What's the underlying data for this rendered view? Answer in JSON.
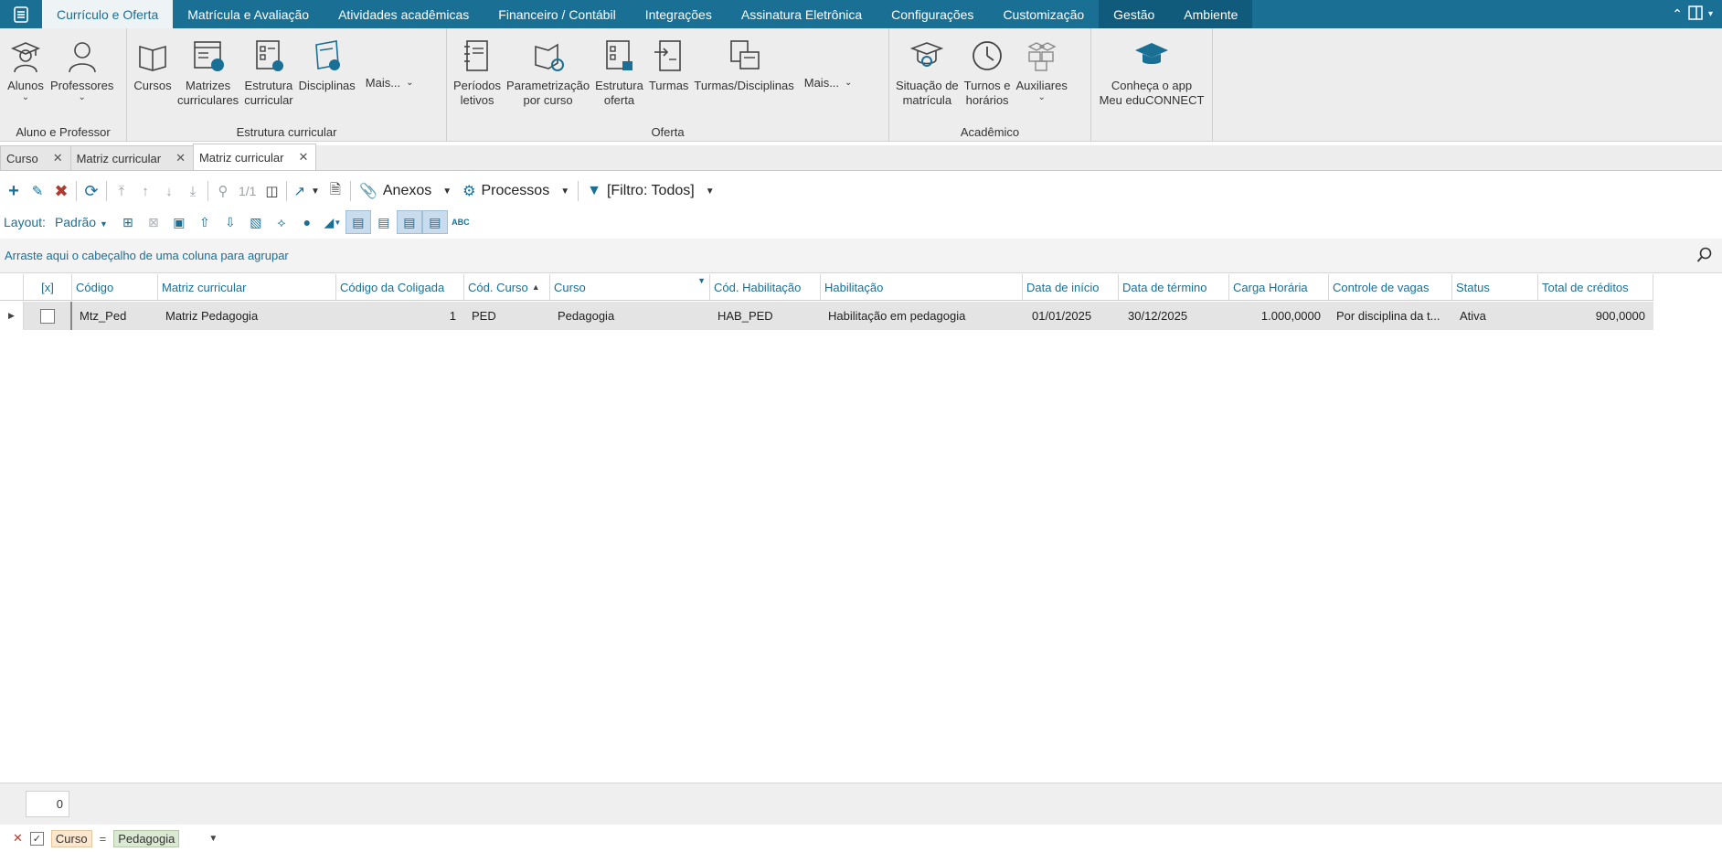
{
  "menubar": {
    "tabs": [
      {
        "label": "Currículo e Oferta",
        "active": true
      },
      {
        "label": "Matrícula e Avaliação"
      },
      {
        "label": "Atividades acadêmicas"
      },
      {
        "label": "Financeiro / Contábil"
      },
      {
        "label": "Integrações"
      },
      {
        "label": "Assinatura Eletrônica"
      },
      {
        "label": "Configurações"
      },
      {
        "label": "Customização"
      },
      {
        "label": "Gestão",
        "alt": true
      },
      {
        "label": "Ambiente",
        "alt": true
      }
    ]
  },
  "ribbon": {
    "group1": {
      "label": "Aluno e Professor",
      "alunos": "Alunos",
      "professores": "Professores"
    },
    "group2": {
      "label": "Estrutura curricular",
      "cursos": "Cursos",
      "matrizes": "Matrizes\ncurriculares",
      "estrutura": "Estrutura\ncurricular",
      "disciplinas": "Disciplinas",
      "mais": "Mais..."
    },
    "group3": {
      "label": "Oferta",
      "periodos": "Períodos\nletivos",
      "parametrizacao": "Parametrização\npor curso",
      "estrutura_oferta": "Estrutura\noferta",
      "turmas": "Turmas",
      "turmas_disciplinas": "Turmas/Disciplinas",
      "mais": "Mais..."
    },
    "group4": {
      "label": "Acadêmico",
      "situacao": "Situação de\nmatrícula",
      "turnos": "Turnos e\nhorários",
      "auxiliares": "Auxiliares"
    },
    "group5": {
      "app": "Conheça o app\nMeu eduCONNECT"
    }
  },
  "doctabs": [
    {
      "label": "Curso"
    },
    {
      "label": "Matriz curricular"
    },
    {
      "label": "Matriz curricular",
      "active": true
    }
  ],
  "toolbar": {
    "record_nav": "1/1",
    "anexos": "Anexos",
    "processos": "Processos",
    "filtro": "[Filtro: Todos]"
  },
  "layoutbar": {
    "label": "Layout:",
    "value": "Padrão"
  },
  "groupbar": {
    "hint": "Arraste aqui o cabeçalho de uma coluna para agrupar"
  },
  "grid": {
    "columns": [
      "[x]",
      "Código",
      "Matriz curricular",
      "Código da Coligada",
      "Cód. Curso",
      "Curso",
      "Cód. Habilitação",
      "Habilitação",
      "Data de início",
      "Data de término",
      "Carga Horária",
      "Controle de vagas",
      "Status",
      "Total de créditos"
    ],
    "rows": [
      {
        "codigo": "Mtz_Ped",
        "matriz": "Matriz Pedagogia",
        "coligada": "1",
        "cod_curso": "PED",
        "curso": "Pedagogia",
        "cod_habilitacao": "HAB_PED",
        "habilitacao": "Habilitação em pedagogia",
        "data_inicio": "01/01/2025",
        "data_termino": "30/12/2025",
        "carga_horaria": "1.000,0000",
        "controle_vagas": "Por disciplina da t...",
        "status": "Ativa",
        "total_creditos": "900,0000"
      }
    ]
  },
  "footer": {
    "count": "0"
  },
  "filterbar": {
    "field": "Curso",
    "operator": "=",
    "value": "Pedagogia"
  },
  "colors": {
    "accent": "#1a6f95",
    "ribbon_bg": "#ededed",
    "row_selected": "#e4e4e4"
  }
}
